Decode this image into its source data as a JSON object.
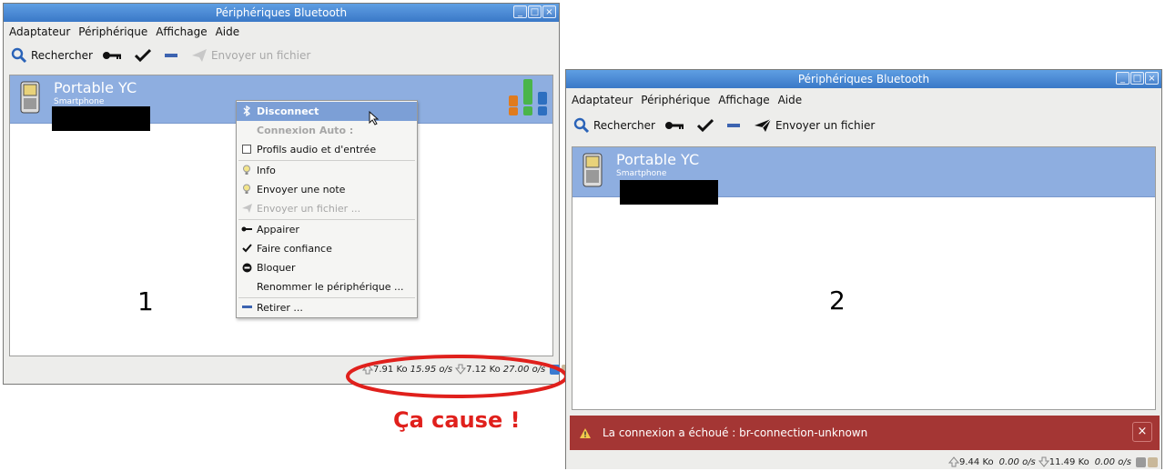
{
  "window1": {
    "title": "Périphériques Bluetooth",
    "menu": [
      "Adaptateur",
      "Périphérique",
      "Affichage",
      "Aide"
    ],
    "toolbar": {
      "search": "Rechercher",
      "send": "Envoyer un fichier"
    },
    "device": {
      "name": "Portable YC",
      "type": "Smartphone"
    },
    "label": "1",
    "context_menu": {
      "disconnect": "Disconnect",
      "auto_header": "Connexion Auto :",
      "audio_profiles": "Profils audio et d'entrée",
      "info": "Info",
      "send_note": "Envoyer une note",
      "send_file": "Envoyer un fichier ...",
      "pair": "Appairer",
      "trust": "Faire confiance",
      "block": "Bloquer",
      "rename": "Renommer le périphérique ...",
      "remove": "Retirer ..."
    },
    "status": {
      "up_size": "7.91 Ko",
      "up_rate": "15.95 o/s",
      "down_size": "7.12 Ko",
      "down_rate": "27.00 o/s"
    }
  },
  "window2": {
    "title": "Périphériques Bluetooth",
    "menu": [
      "Adaptateur",
      "Périphérique",
      "Affichage",
      "Aide"
    ],
    "toolbar": {
      "search": "Rechercher",
      "send": "Envoyer un fichier"
    },
    "device": {
      "name": "Portable YC",
      "type": "Smartphone"
    },
    "label": "2",
    "error": "La connexion a échoué : br-connection-unknown",
    "status": {
      "up_size": "9.44 Ko",
      "up_rate": "0.00 o/s",
      "down_size": "11.49 Ko",
      "down_rate": "0.00 o/s"
    }
  },
  "annotation": "Ça cause !",
  "colors": {
    "titlebar": "#3a78c7",
    "selection": "#8eaee0",
    "error": "#a43634",
    "annotation": "#e0201c"
  }
}
